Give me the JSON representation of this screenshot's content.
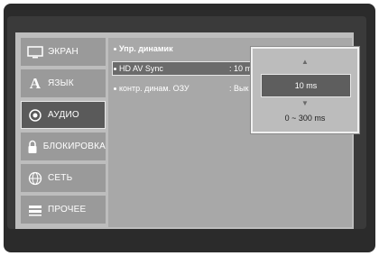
{
  "sidebar": {
    "items": [
      {
        "label": "ЭКРАН",
        "icon": "tv-screen-icon"
      },
      {
        "label": "ЯЗЫК",
        "icon": "language-icon"
      },
      {
        "label": "АУДИО",
        "icon": "audio-icon"
      },
      {
        "label": "БЛОКИРОВКА",
        "icon": "lock-icon"
      },
      {
        "label": "СЕТЬ",
        "icon": "network-icon"
      },
      {
        "label": "ПРОЧЕЕ",
        "icon": "other-icon"
      }
    ],
    "active_index": 2
  },
  "content": {
    "header": "Упр. динамик",
    "rows": [
      {
        "label": "HD AV Sync",
        "value": ": 10 m"
      },
      {
        "label": "контр. динам. ОЗУ",
        "value": ": Вык"
      }
    ]
  },
  "popup": {
    "up_arrow": "▲",
    "value": "10 ms",
    "down_arrow": "▼",
    "range": "0 ~ 300 ms"
  }
}
